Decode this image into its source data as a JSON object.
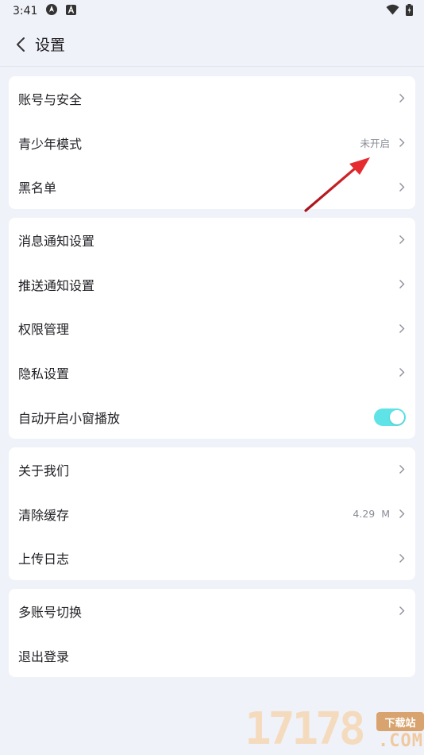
{
  "status_bar": {
    "time": "3:41",
    "icons": [
      "location-icon",
      "a-badge-icon",
      "wifi-icon",
      "battery-icon"
    ]
  },
  "header": {
    "title": "设置"
  },
  "groups": [
    {
      "rows": [
        {
          "label": "账号与安全",
          "value": ""
        },
        {
          "label": "青少年模式",
          "value": "未开启"
        },
        {
          "label": "黑名单",
          "value": ""
        }
      ]
    },
    {
      "rows": [
        {
          "label": "消息通知设置",
          "value": ""
        },
        {
          "label": "推送通知设置",
          "value": ""
        },
        {
          "label": "权限管理",
          "value": ""
        },
        {
          "label": "隐私设置",
          "value": ""
        },
        {
          "label": "自动开启小窗播放",
          "toggle": true
        }
      ]
    },
    {
      "rows": [
        {
          "label": "关于我们",
          "value": ""
        },
        {
          "label": "清除缓存",
          "value": "4.29  M"
        },
        {
          "label": "上传日志",
          "value": ""
        }
      ]
    },
    {
      "rows": [
        {
          "label": "多账号切换",
          "value": ""
        },
        {
          "label": "退出登录",
          "value": ""
        }
      ]
    }
  ],
  "watermark": {
    "digits": "17178",
    "badge": "下载站",
    "suffix": ".COM"
  },
  "colors": {
    "background": "#f0f2f9",
    "card": "#ffffff",
    "toggle_on": "#5fe3e7",
    "annotation_arrow": "#d9252a"
  }
}
